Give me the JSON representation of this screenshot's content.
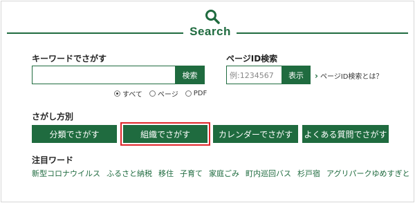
{
  "header": {
    "title": "Search",
    "icon": "search-icon"
  },
  "keyword": {
    "label": "キーワードでさがす",
    "input_value": "",
    "button": "検索",
    "radios": [
      {
        "label": "すべて",
        "selected": true
      },
      {
        "label": "ページ",
        "selected": false
      },
      {
        "label": "PDF",
        "selected": false
      }
    ]
  },
  "page_id": {
    "label": "ページID検索",
    "placeholder": "例:1234567",
    "button": "表示",
    "link": "ページID検索とは？"
  },
  "method": {
    "label": "さがし方別",
    "buttons": [
      "分類でさがす",
      "組織でさがす",
      "カレンダーでさがす",
      "よくある質問でさがす"
    ]
  },
  "featured": {
    "label": "注目ワード",
    "words": [
      "新型コロナウイルス",
      "ふるさと納税",
      "移住",
      "子育て",
      "家庭ごみ",
      "町内巡回バス",
      "杉戸宿",
      "アグリパークゆめすぎと"
    ]
  },
  "colors": {
    "brand_green": "#1f6b3f",
    "highlight_red": "#e0252a"
  }
}
